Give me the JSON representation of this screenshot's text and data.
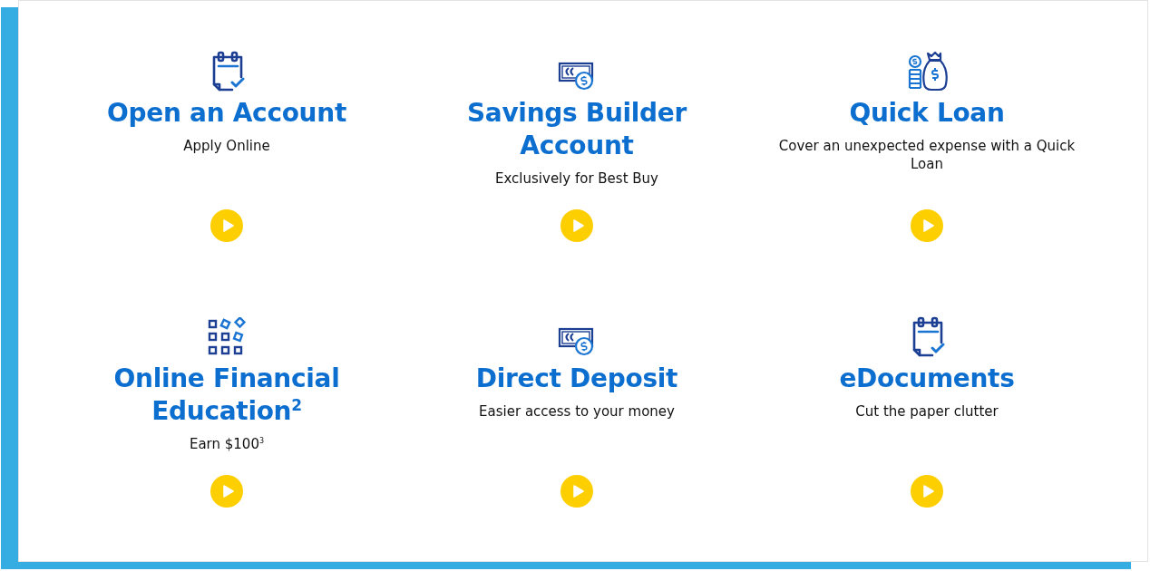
{
  "tiles": [
    {
      "kind": "calendar",
      "title": "Open an Account",
      "subtitle": "Apply Online"
    },
    {
      "kind": "cash",
      "title": "Savings Builder Account",
      "subtitle": "Exclusively for Best Buy"
    },
    {
      "kind": "moneybag",
      "title": "Quick Loan",
      "subtitle": "Cover an unexpected expense with a Quick Loan"
    },
    {
      "kind": "grid",
      "title": "Online Financial Education$^{2}$",
      "subtitle": "Earn $100$^{3}$"
    },
    {
      "kind": "cash",
      "title": "Direct Deposit",
      "subtitle": "Easier access to your money"
    },
    {
      "kind": "calendar",
      "title": "eDocuments",
      "subtitle": "Cut the paper clutter"
    }
  ]
}
